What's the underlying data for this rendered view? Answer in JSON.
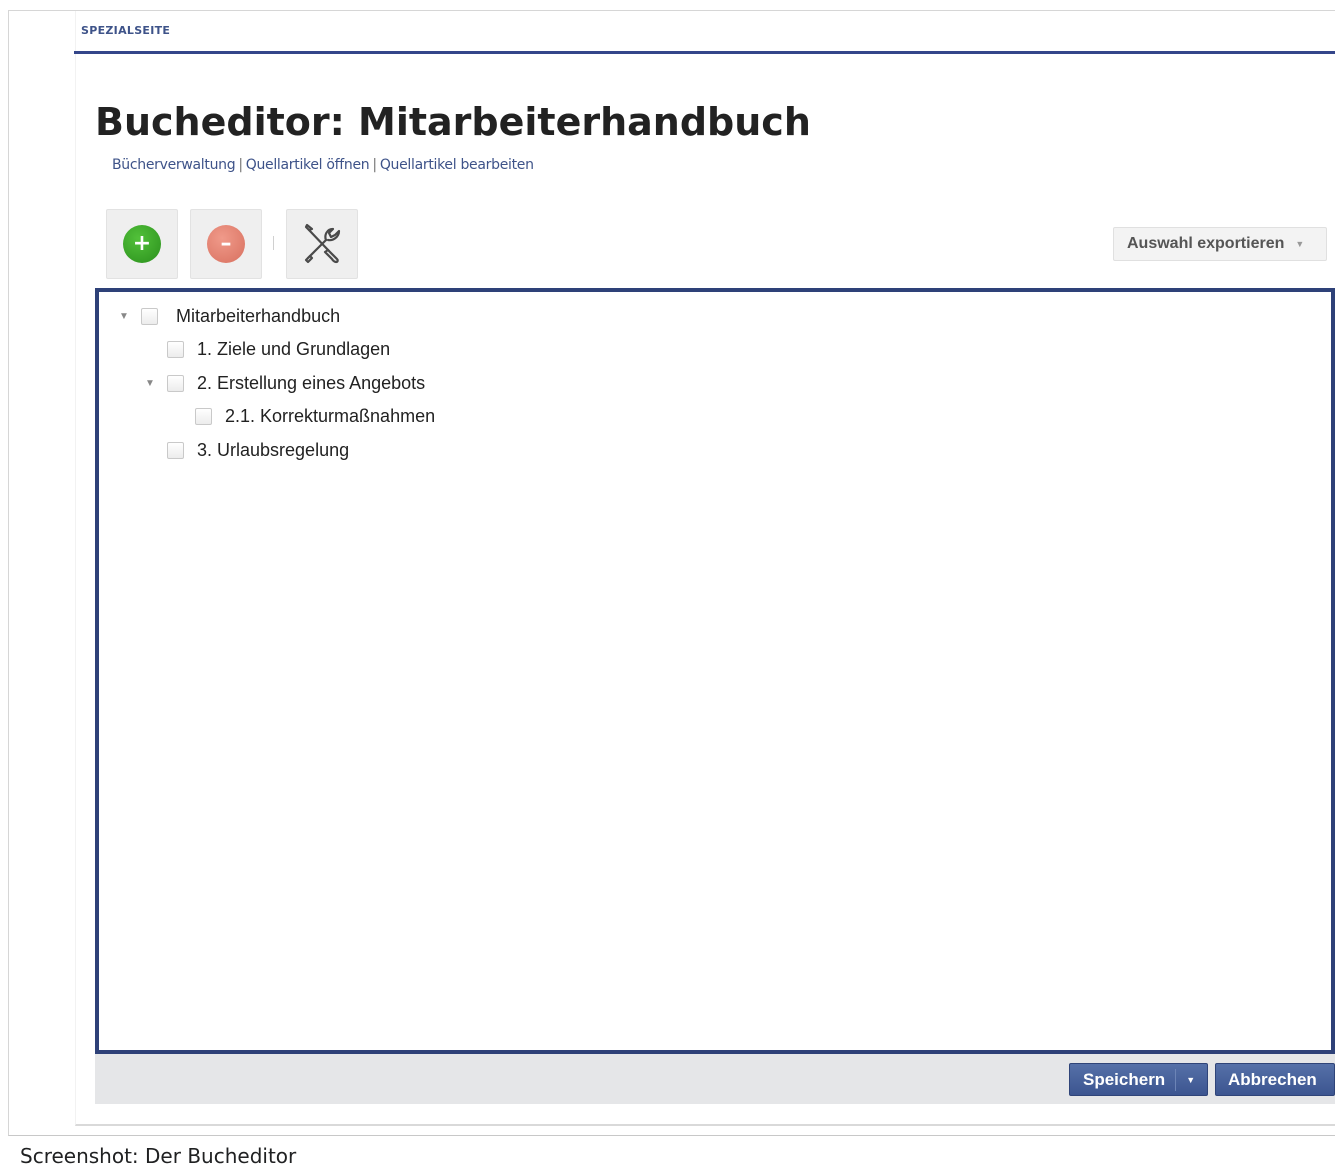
{
  "header": {
    "special_tag": "SPEZIALSEITE",
    "title": "Bucheditor: Mitarbeiterhandbuch",
    "links": [
      "Bücherverwaltung",
      "Quellartikel öffnen",
      "Quellartikel bearbeiten"
    ],
    "link_separator": "|"
  },
  "toolbar": {
    "add_symbol": "+",
    "remove_symbol": "–",
    "add_icon": "plus-circle-icon",
    "remove_icon": "minus-circle-icon",
    "tools_icon": "wrench-screwdriver-icon",
    "export_label": "Auswahl exportieren",
    "export_caret": "▼"
  },
  "tree": {
    "nodes": [
      {
        "label": "Mitarbeiterhandbuch",
        "expanded": true,
        "checked": false
      },
      {
        "label": "1. Ziele und Grundlagen",
        "checked": false
      },
      {
        "label": "2. Erstellung eines Angebots",
        "expanded": true,
        "checked": false
      },
      {
        "label": "2.1. Korrekturmaßnahmen",
        "checked": false
      },
      {
        "label": "3. Urlaubsregelung",
        "checked": false
      }
    ],
    "toggle_symbol": "▼"
  },
  "actions": {
    "save_label": "Speichern",
    "save_caret": "▼",
    "cancel_label": "Abbrechen"
  },
  "caption": "Screenshot: Der Bucheditor",
  "colors": {
    "accent": "#34468a",
    "panel_border": "#2e4178",
    "button_blue": "#3c5590",
    "add_green": "#2a8f1c",
    "remove_red": "#d8705f"
  }
}
